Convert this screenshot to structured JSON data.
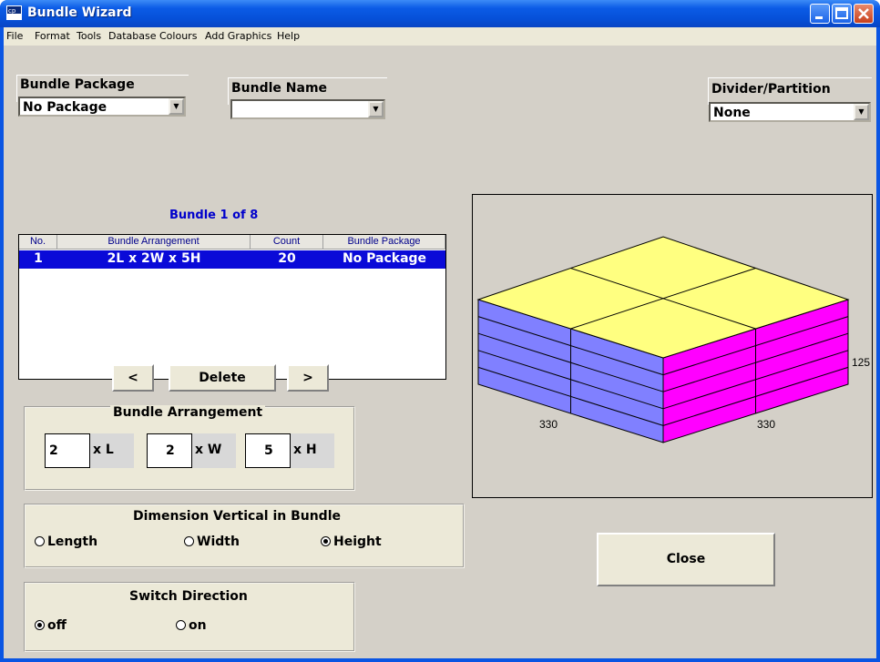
{
  "window": {
    "title": "Bundle Wizard"
  },
  "menu": [
    "File",
    "Format",
    "Tools",
    "Database",
    "Colours",
    "Add Graphics",
    "Help"
  ],
  "bundle_package": {
    "label": "Bundle Package",
    "value": "No Package"
  },
  "bundle_name": {
    "label": "Bundle Name",
    "value": ""
  },
  "divider": {
    "label": "Divider/Partition",
    "value": "None"
  },
  "bundle_caption": "Bundle  1 of 8",
  "table": {
    "headers": [
      "No.",
      "Bundle Arrangement",
      "Count",
      "Bundle Package"
    ],
    "rows": [
      {
        "no": "1",
        "arrangement": "2L x 2W x 5H",
        "count": "20",
        "package": "No Package"
      }
    ]
  },
  "nav": {
    "prev": "<",
    "delete": "Delete",
    "next": ">"
  },
  "arrangement": {
    "title": "Bundle Arrangement",
    "length": "2",
    "length_label": "x L",
    "width": "2",
    "width_label": "x W",
    "height": "5",
    "height_label": "x H"
  },
  "vertical": {
    "title": "Dimension Vertical in Bundle",
    "options": [
      "Length",
      "Width",
      "Height"
    ],
    "selected": "Height"
  },
  "switch": {
    "title": "Switch Direction",
    "options": [
      "off",
      "on"
    ],
    "selected": "off"
  },
  "view": {
    "dim_height": "125",
    "dim_left": "330",
    "dim_right": "330"
  },
  "colors": {
    "top": "#ffff80",
    "left": "#8080ff",
    "right": "#ff00ff"
  },
  "close_button": "Close"
}
